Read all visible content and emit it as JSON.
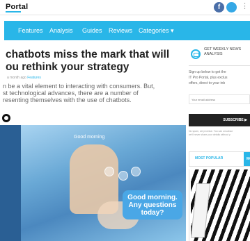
{
  "header": {
    "logo": "Portal",
    "facebook_glyph": "f",
    "more_glyph": "⋮"
  },
  "nav": {
    "items": [
      "Features",
      "Analysis",
      "Guides",
      "Reviews",
      "Categories ▾"
    ]
  },
  "article": {
    "title_line1": "chatbots miss the mark that will",
    "title_line2": "ou rethink your strategy",
    "meta_time": "a month ago",
    "meta_category": "Features",
    "excerpt_lines": [
      "n be a vital element to interacting with consumers. But,",
      "st technological advances, there are a number of",
      "resenting themselves with the use of chatbots."
    ],
    "hero_bubble": "Good morning. Any questions today?",
    "hero_small_text": "Good morning"
  },
  "sidebar": {
    "newsletter_title": "GET WEEKLY NEWS ANALYSIS",
    "newsletter_text_lines": [
      "Sign up below to get the",
      "IT Pro Portal, plus exclus",
      "offers, direct to your inb"
    ],
    "email_placeholder": "Your email address",
    "subscribe_label": "SUBSCRIBE ▶",
    "fine_print_lines": [
      "No spam, we promise. You can unsubscr",
      "we'll never share your details without y"
    ],
    "tabs": [
      "MOST POPULAR",
      "MO"
    ]
  },
  "colors": {
    "accent": "#29b6e8",
    "nav_bg": "#29b6e8",
    "hero_bg": "#2a5f94",
    "button_bg": "#222222"
  },
  "icons": [
    "facebook-icon",
    "twitter-icon",
    "more-icon",
    "mail-icon"
  ]
}
